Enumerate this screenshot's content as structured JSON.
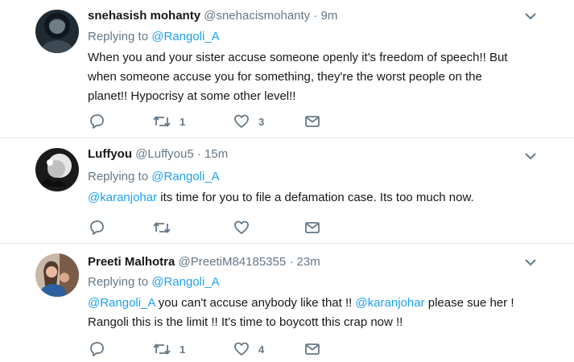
{
  "tweets": [
    {
      "name": "snehasish mohanty",
      "handle": "@snehacismohanty",
      "dot": "·",
      "time": "9m",
      "replying_label": "Replying to",
      "replying_to": "@Rangoli_A",
      "text_lines": [
        "When you and your sister accuse someone openly it's freedom of speech!! But",
        "when someone accuse you for something, they're the worst people on the",
        "planet!! Hypocrisy at some other level!!"
      ],
      "retweets": "1",
      "likes": "3"
    },
    {
      "name": "Luffyou",
      "handle": "@Luffyou5",
      "dot": "·",
      "time": "15m",
      "replying_label": "Replying to",
      "replying_to": "@Rangoli_A",
      "text_mention": "@karanjohar",
      "text_rest": " its time for you to file a defamation case. Its too much now.",
      "retweets": "",
      "likes": ""
    },
    {
      "name": "Preeti Malhotra",
      "handle": "@PreetiM84185355",
      "dot": "·",
      "time": "23m",
      "replying_label": "Replying to",
      "replying_to": "@Rangoli_A",
      "line1_mention1": "@Rangoli_A",
      "line1_mid": " you can't accuse anybody like that !! ",
      "line1_mention2": "@karanjohar",
      "line1_end": " please sue her !",
      "line2": "Rangoli this is the limit !! It's time to boycott this crap now !!",
      "retweets": "1",
      "likes": "4"
    }
  ],
  "colors": {
    "link": "#1da1f2",
    "muted": "#657786",
    "text": "#14171a",
    "divider": "#e1e8ed"
  },
  "icons": [
    "reply-icon",
    "retweet-icon",
    "heart-icon",
    "envelope-icon",
    "chevron-down-icon"
  ]
}
